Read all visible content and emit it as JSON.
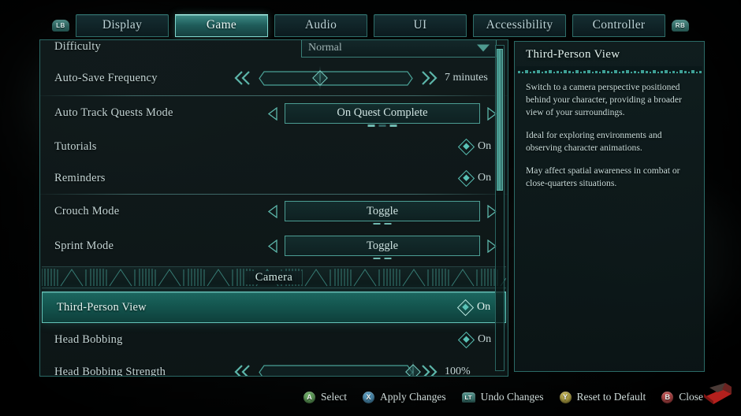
{
  "nav": {
    "left_shoulder": "LB",
    "right_shoulder": "RB",
    "tabs": [
      {
        "label": "Display",
        "active": false
      },
      {
        "label": "Game",
        "active": true
      },
      {
        "label": "Audio",
        "active": false
      },
      {
        "label": "UI",
        "active": false
      },
      {
        "label": "Accessibility",
        "active": false
      },
      {
        "label": "Controller",
        "active": false
      }
    ]
  },
  "settings": {
    "rows": [
      {
        "id": "difficulty",
        "label": "Difficulty",
        "type": "dropdown",
        "value": "Normal",
        "partial_top": true
      },
      {
        "id": "auto-save-frequency",
        "label": "Auto-Save Frequency",
        "type": "slider",
        "value": "7 minutes",
        "percent": 40
      },
      {
        "id": "auto-track-quests-mode",
        "label": "Auto Track Quests Mode",
        "type": "stepper",
        "value": "On Quest Complete",
        "option_index": 3,
        "option_count": 3,
        "separator_above": true
      },
      {
        "id": "tutorials",
        "label": "Tutorials",
        "type": "toggle",
        "value": "On"
      },
      {
        "id": "reminders",
        "label": "Reminders",
        "type": "toggle",
        "value": "On"
      },
      {
        "id": "crouch-mode",
        "label": "Crouch Mode",
        "type": "stepper",
        "value": "Toggle",
        "option_index": 2,
        "option_count": 2,
        "separator_above": true
      },
      {
        "id": "sprint-mode",
        "label": "Sprint Mode",
        "type": "stepper",
        "value": "Toggle",
        "option_index": 2,
        "option_count": 2
      }
    ],
    "section": {
      "label": "Camera"
    },
    "camera_rows": [
      {
        "id": "third-person-view",
        "label": "Third-Person View",
        "type": "toggle",
        "value": "On",
        "selected": true
      },
      {
        "id": "head-bobbing",
        "label": "Head Bobbing",
        "type": "toggle",
        "value": "On"
      },
      {
        "id": "head-bobbing-strength",
        "label": "Head Bobbing Strength",
        "type": "slider",
        "value": "100%",
        "percent": 100
      }
    ]
  },
  "info": {
    "title": "Third-Person View",
    "paragraphs": [
      "Switch to a camera perspective positioned behind your character, providing a broader view of your surroundings.",
      "Ideal for exploring environments and observing character animations.",
      "May affect spatial awareness in combat or close-quarters situations."
    ]
  },
  "prompts": [
    {
      "glyph": "A",
      "label": "Select",
      "color": "#4f8a4a",
      "kind": "round"
    },
    {
      "glyph": "X",
      "label": "Apply Changes",
      "color": "#3e7fa4",
      "kind": "round"
    },
    {
      "glyph": "LT",
      "label": "Undo Changes",
      "color": "#3f7b76",
      "kind": "trigger"
    },
    {
      "glyph": "Y",
      "label": "Reset to Default",
      "color": "#9b8f38",
      "kind": "round"
    },
    {
      "glyph": "B",
      "label": "Close",
      "color": "#9e3b3b",
      "kind": "round"
    }
  ],
  "colors": {
    "accent": "#59c2b6",
    "panel_border": "#2b6a66",
    "highlight": "#1c6760",
    "text": "#c3d4d4"
  }
}
